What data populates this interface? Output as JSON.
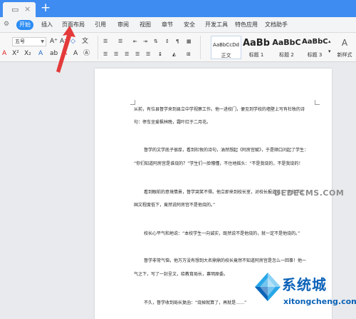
{
  "tabs": {
    "new_tab": "+"
  },
  "menu": {
    "start_label": "开始",
    "items": [
      "插入",
      "页面布局",
      "引用",
      "审阅",
      "视图",
      "章节",
      "安全",
      "开发工具",
      "特色应用",
      "文档助手"
    ]
  },
  "ribbon": {
    "font_size": "五号",
    "styles": [
      {
        "preview": "AaBbCcDd",
        "label": "正文"
      },
      {
        "preview": "AaBb",
        "label": "标题 1"
      },
      {
        "preview": "AaBbC",
        "label": "标题 2"
      },
      {
        "preview": "AaBbC",
        "label": "标题 3"
      }
    ],
    "new_style_label": "新样式"
  },
  "document": {
    "paragraphs": [
      "从前，有位县督学来到县立中学视察工作。他一进校门，便见到学校的墙壁上写有杜牧的诗",
      "句：停车坐爱枫林晚，霜叶红于二月花。",
      "督学的文学底子很厚，看到杜牧的诗句，油然想起《阿房宫赋》，于是顺口问起了学生：",
      "“你们知道阿房宫是谁烧的？”学生们一脸懵懂，不住地摇头：“不是我烧的，不是我烧的！",
      "看到眼前的意境情景，督学哭笑不得。他立即来到校长室，对校长报道道：“贵校学生",
      "国文程度低下，竟然说阿房宫不是他烧的。”",
      "校长心平气和地说：“本校学生一向诚实，既然说不是他烧的，就一定不是他烧的。”",
      "督学非常气恼，他万万没有想到大名鼎鼎的校长竟然不知道阿房宫是怎么一回事！他一",
      "气之下，写了一封呈文，给教育局长，禀明原委。",
      "不久，督学收到局长复函：“烧掉就算了，再就是……”"
    ]
  },
  "watermark": {
    "title": "系统城",
    "url": "xitongcheng.com",
    "site": "DEDECMS.COM",
    "colors": {
      "blue": "#0c63b8",
      "sky": "#29a7e8"
    }
  },
  "colors": {
    "accent": "#3e8cf1",
    "arrow": "#e43a3a"
  }
}
